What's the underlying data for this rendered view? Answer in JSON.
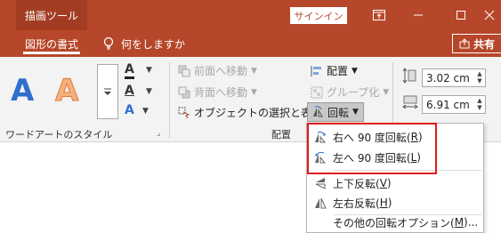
{
  "titlebar": {
    "context_tab": "描画ツール",
    "signin": "サインイン"
  },
  "tabs": {
    "active": "図形の書式",
    "tellme": "何をしますか",
    "share": "共有"
  },
  "ribbon": {
    "wordart_group_label": "ワードアートのスタイル",
    "wordart_letter": "A",
    "arrange_group_label": "配置",
    "bring_forward": "前面へ移動",
    "send_backward": "背面へ移動",
    "selection_pane": "オブジェクトの選択と表示",
    "align": "配置",
    "group": "グループ化",
    "rotate": "回転",
    "height_value": "3.02 cm",
    "width_value": "6.91 cm"
  },
  "menu": {
    "items": [
      {
        "label": "右へ 90 度回転(",
        "key": "R",
        "suffix": ")"
      },
      {
        "label": "左へ 90 度回転(",
        "key": "L",
        "suffix": ")"
      },
      {
        "label": "上下反転(",
        "key": "V",
        "suffix": ")"
      },
      {
        "label": "左右反転(",
        "key": "H",
        "suffix": ")"
      },
      {
        "label": "その他の回転オプション(",
        "key": "M",
        "suffix": ")..."
      }
    ]
  },
  "colors": {
    "accent": "#b7472a",
    "highlight": "#e21a1a",
    "wordart_blue": "#2f6fce",
    "wordart_orange": "#f0a050"
  }
}
